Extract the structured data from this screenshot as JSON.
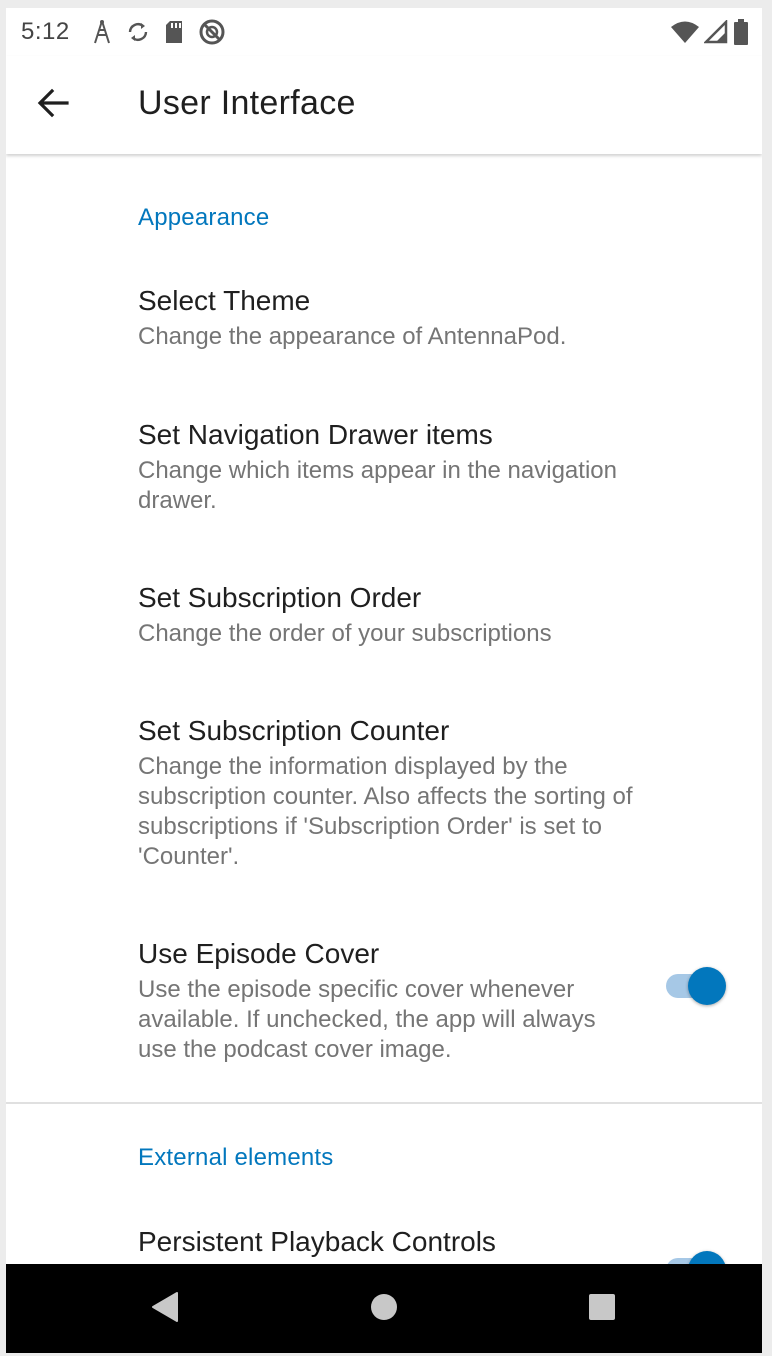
{
  "status_bar": {
    "time": "5:12",
    "icons_left": [
      "antenna-icon",
      "sync-icon",
      "sd-card-icon",
      "do-not-disturb-icon"
    ],
    "icons_right": [
      "wifi-icon",
      "cell-signal-icon",
      "battery-icon"
    ]
  },
  "app_bar": {
    "title": "User Interface",
    "back_icon": "arrow-back-icon"
  },
  "sections": {
    "appearance": {
      "header": "Appearance",
      "items": [
        {
          "title": "Select Theme",
          "summary": "Change the appearance of AntennaPod."
        },
        {
          "title": "Set Navigation Drawer items",
          "summary": "Change which items appear in the navigation drawer."
        },
        {
          "title": "Set Subscription Order",
          "summary": "Change the order of your subscriptions"
        },
        {
          "title": "Set Subscription Counter",
          "summary": "Change the information displayed by the subscription counter. Also affects the sorting of subscriptions if 'Subscription Order' is set to 'Counter'."
        },
        {
          "title": "Use Episode Cover",
          "summary": "Use the episode specific cover whenever available. If unchecked, the app will always use the podcast cover image.",
          "switch_on": true
        }
      ]
    },
    "external": {
      "header": "External elements",
      "items": [
        {
          "title": "Persistent Playback Controls",
          "switch_on": true
        }
      ]
    }
  },
  "nav_bar": {
    "icons": [
      "nav-back-icon",
      "nav-home-icon",
      "nav-recents-icon"
    ]
  },
  "colors": {
    "accent": "#0277bd",
    "switch_track": "#a6c8e6",
    "title_text": "#1f1f1f",
    "summary_text": "#757575",
    "nav_bar": "#000000"
  }
}
